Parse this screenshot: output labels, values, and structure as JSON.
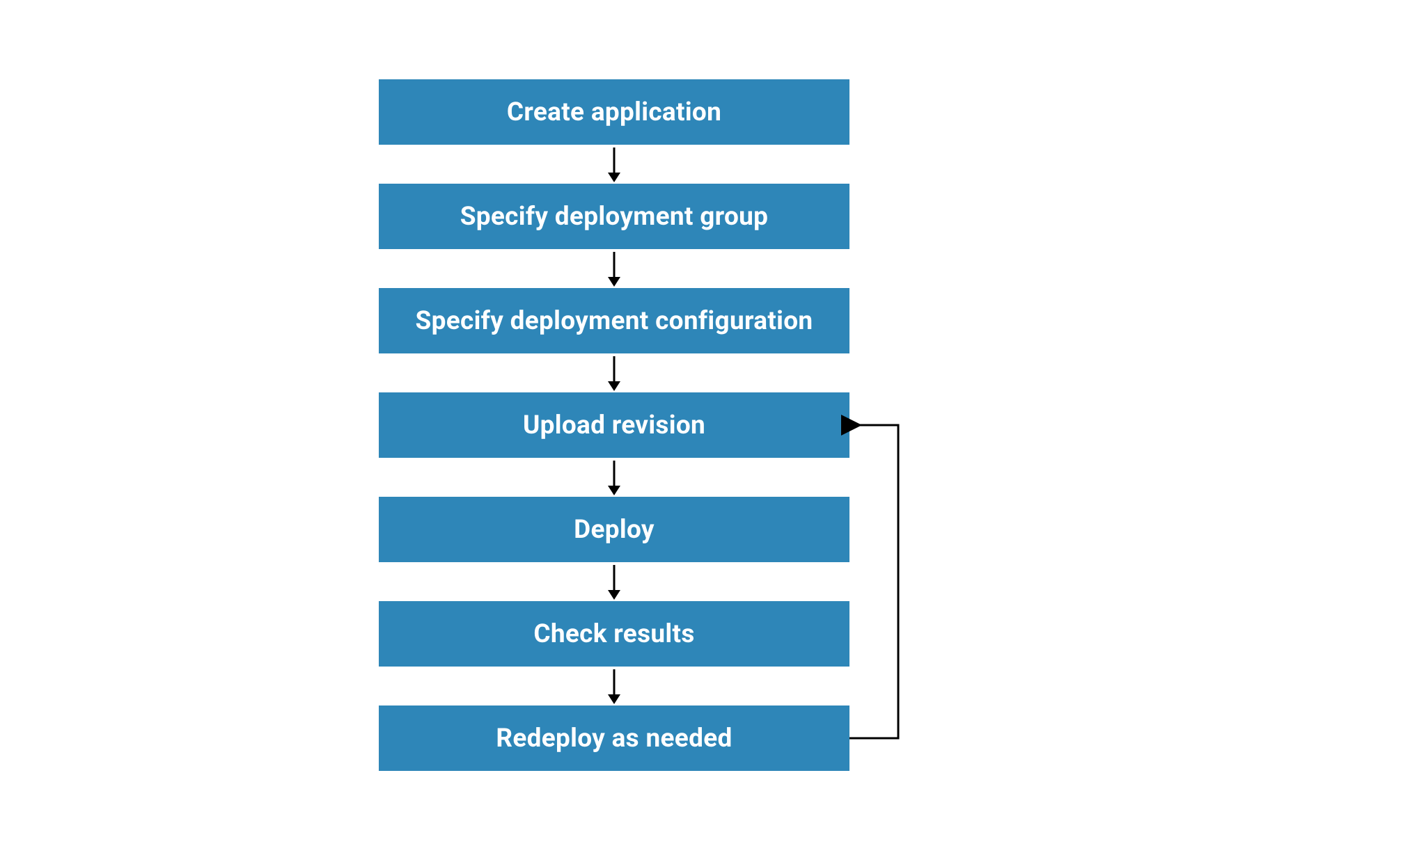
{
  "flowchart": {
    "steps": [
      {
        "id": "create-application",
        "label": "Create application"
      },
      {
        "id": "specify-deployment-group",
        "label": "Specify deployment group"
      },
      {
        "id": "specify-deployment-configuration",
        "label": "Specify deployment configuration"
      },
      {
        "id": "upload-revision",
        "label": "Upload revision"
      },
      {
        "id": "deploy",
        "label": "Deploy"
      },
      {
        "id": "check-results",
        "label": "Check results"
      },
      {
        "id": "redeploy-as-needed",
        "label": "Redeploy as needed"
      }
    ],
    "loop": {
      "from": "redeploy-as-needed",
      "to": "upload-revision"
    },
    "colors": {
      "box_bg": "#2e86b8",
      "box_text": "#ffffff",
      "arrow": "#000000"
    }
  }
}
